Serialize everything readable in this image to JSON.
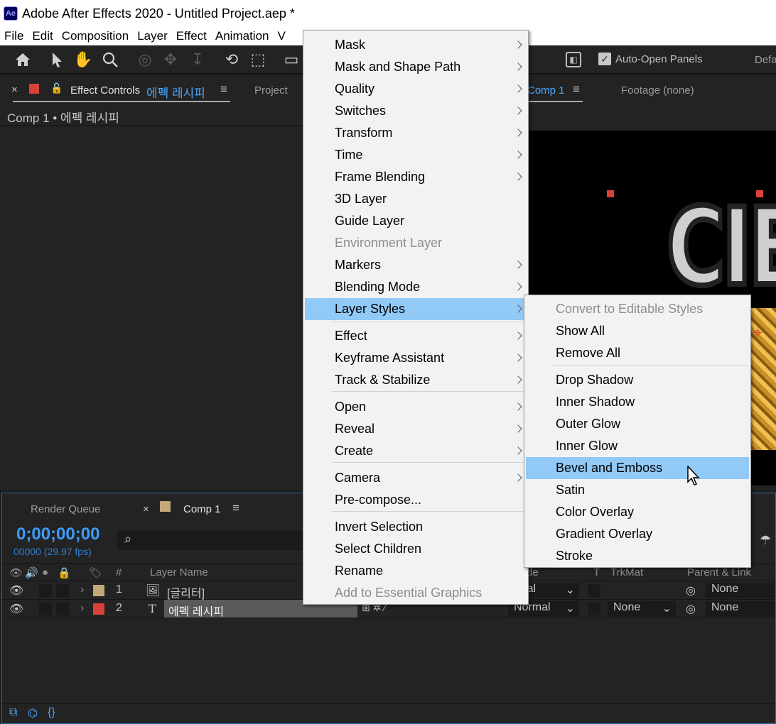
{
  "app": {
    "logo": "Ae",
    "title": "Adobe After Effects 2020 - Untitled Project.aep *"
  },
  "menubar": [
    "File",
    "Edit",
    "Composition",
    "Layer",
    "Effect",
    "Animation",
    "V"
  ],
  "toolbar": {
    "icons": [
      "home-icon",
      "selection-arrow-icon",
      "hand-icon",
      "zoom-icon",
      "orbit-icon",
      "pan-icon",
      "dolly-icon",
      "rotate-icon",
      "pan-behind-icon",
      "rectangle-icon"
    ],
    "auto_open_label": "Auto-Open Panels",
    "auto_open_checked": true,
    "workspace_label": "Defa"
  },
  "effect_controls": {
    "tab_label": "Effect Controls",
    "target": "에펙 레시피",
    "breadcrumb": "Comp 1 • 에펙 레시피",
    "project_tab": "Project",
    "layer_color": "#d9423a"
  },
  "viewer": {
    "comp_tab": "Comp 1",
    "footage_tab": "Footage  (none)",
    "sub_label": "′",
    "art_text": "CIE"
  },
  "layer_menu": {
    "items": [
      {
        "label": "Mask",
        "submenu": true
      },
      {
        "label": "Mask and Shape Path",
        "submenu": true
      },
      {
        "label": "Quality",
        "submenu": true
      },
      {
        "label": "Switches",
        "submenu": true
      },
      {
        "label": "Transform",
        "submenu": true
      },
      {
        "label": "Time",
        "submenu": true
      },
      {
        "label": "Frame Blending",
        "submenu": true
      },
      {
        "label": "3D Layer"
      },
      {
        "label": "Guide Layer"
      },
      {
        "label": "Environment Layer",
        "disabled": true
      },
      {
        "label": "Markers",
        "submenu": true
      },
      {
        "label": "Blending Mode",
        "submenu": true
      },
      {
        "label": "Layer Styles",
        "submenu": true,
        "highlighted": true
      },
      {
        "label": "Effect",
        "submenu": true
      },
      {
        "label": "Keyframe Assistant",
        "submenu": true
      },
      {
        "label": "Track & Stabilize",
        "submenu": true
      },
      {
        "label": "Open",
        "submenu": true
      },
      {
        "label": "Reveal",
        "submenu": true
      },
      {
        "label": "Create",
        "submenu": true
      },
      {
        "label": "Camera",
        "submenu": true
      },
      {
        "label": "Pre-compose..."
      },
      {
        "label": "Invert Selection"
      },
      {
        "label": "Select Children"
      },
      {
        "label": "Rename"
      },
      {
        "label": "Add to Essential Graphics",
        "disabled": true
      }
    ]
  },
  "layer_styles_submenu": {
    "items": [
      {
        "label": "Convert to Editable Styles",
        "disabled": true
      },
      {
        "label": "Show All"
      },
      {
        "label": "Remove All"
      },
      {
        "label": "Drop Shadow"
      },
      {
        "label": "Inner Shadow"
      },
      {
        "label": "Outer Glow"
      },
      {
        "label": "Inner Glow"
      },
      {
        "label": "Bevel and Emboss",
        "highlighted": true
      },
      {
        "label": "Satin"
      },
      {
        "label": "Color Overlay"
      },
      {
        "label": "Gradient Overlay"
      },
      {
        "label": "Stroke"
      }
    ]
  },
  "timeline": {
    "render_queue_tab": "Render Queue",
    "comp_tab": "Comp 1",
    "timecode": "0;00;00;00",
    "frame_info": "00000 (29.97 fps)",
    "search_placeholder": "",
    "columns": {
      "number": "#",
      "layer_name": "Layer Name",
      "mode": "de",
      "t": "T",
      "trkmat": "TrkMat",
      "parent": "Parent & Link"
    },
    "layers": [
      {
        "number": "1",
        "type_icon": "footage-icon",
        "name": "[글리터]",
        "label_color": "#c2a878",
        "mode": "rmal",
        "trkmat": "",
        "parent": "None"
      },
      {
        "number": "2",
        "type_icon": "T",
        "name": "에펙 레시피",
        "label_color": "#d9423a",
        "mode": "Normal",
        "trkmat": "None",
        "parent": "None"
      }
    ]
  }
}
